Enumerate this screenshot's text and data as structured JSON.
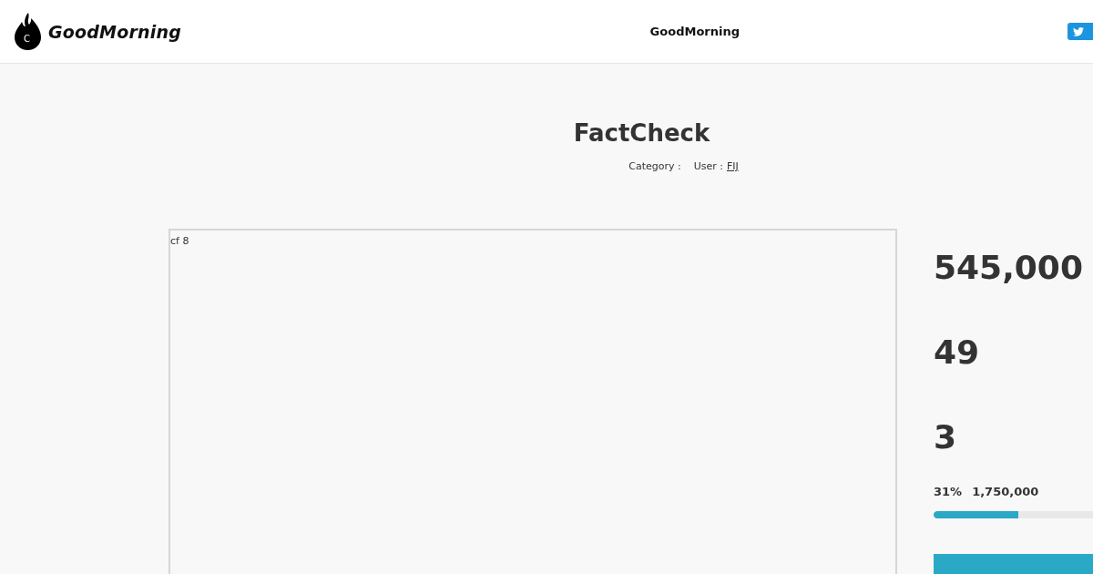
{
  "header": {
    "logo": {
      "mark": "C",
      "text": "GoodMorning"
    },
    "site_name": "GoodMorning"
  },
  "post": {
    "title": "FactCheck",
    "category_label": "Category :",
    "user_label": "User :",
    "user": "FIJ"
  },
  "embed": {
    "text": "cf 8"
  },
  "stats": [
    "545,000",
    "49",
    "3"
  ],
  "funding": {
    "percent": "31%",
    "goal": "1,750,000",
    "level": 0.31
  }
}
